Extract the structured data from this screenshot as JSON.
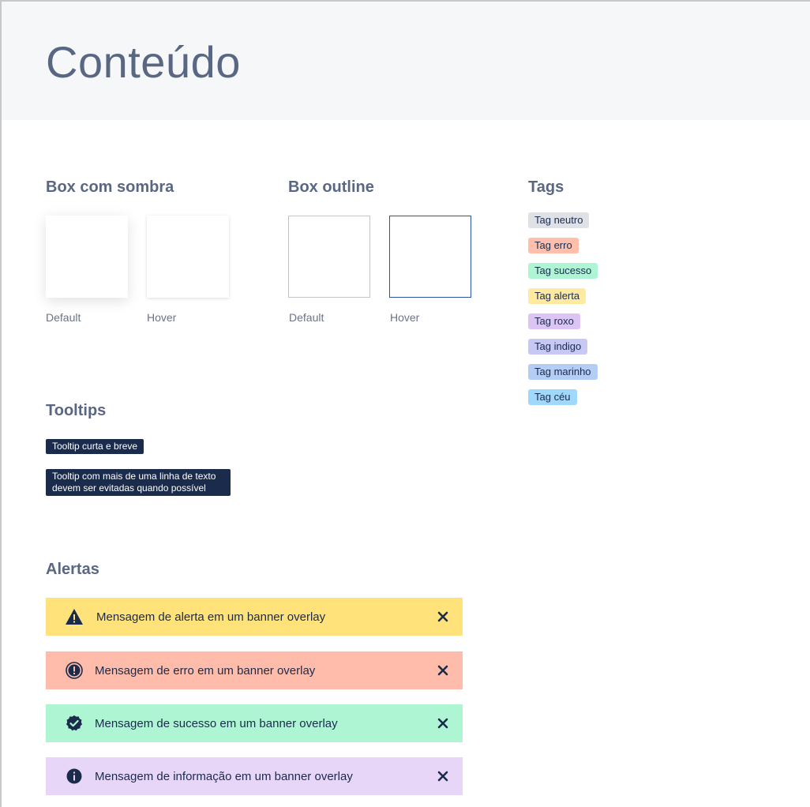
{
  "header": {
    "title": "Conteúdo"
  },
  "sections": {
    "box_shadow": {
      "title": "Box com sombra",
      "default_label": "Default",
      "hover_label": "Hover"
    },
    "box_outline": {
      "title": "Box outline",
      "default_label": "Default",
      "hover_label": "Hover"
    },
    "tags": {
      "title": "Tags",
      "items": [
        {
          "label": "Tag neutro",
          "color": "#dfe1e6"
        },
        {
          "label": "Tag erro",
          "color": "#ffbfaa"
        },
        {
          "label": "Tag sucesso",
          "color": "#aef5d3"
        },
        {
          "label": "Tag alerta",
          "color": "#ffeaa0"
        },
        {
          "label": "Tag roxo",
          "color": "#dcc4f5"
        },
        {
          "label": "Tag indigo",
          "color": "#c8c8f5"
        },
        {
          "label": "Tag marinho",
          "color": "#b4cdf5"
        },
        {
          "label": "Tag céu",
          "color": "#9fd8fb"
        }
      ]
    },
    "tooltips": {
      "title": "Tooltips",
      "short": "Tooltip curta e breve",
      "long_line1": "Tooltip com mais de uma linha de texto",
      "long_line2": "devem ser evitadas quando possível"
    },
    "alerts": {
      "title": "Alertas",
      "items": [
        {
          "type": "warning",
          "icon": "warning-triangle-icon",
          "message": "Mensagem de alerta em um banner overlay",
          "color": "#ffe27a"
        },
        {
          "type": "error",
          "icon": "error-circle-icon",
          "message": "Mensagem de erro em um banner overlay",
          "color": "#ffbcaa"
        },
        {
          "type": "success",
          "icon": "check-circle-icon",
          "message": "Mensagem de sucesso em um banner overlay",
          "color": "#aef6d3"
        },
        {
          "type": "info",
          "icon": "info-circle-icon",
          "message": "Mensagem de informação em um banner overlay",
          "color": "#e8d6f8"
        }
      ]
    }
  }
}
